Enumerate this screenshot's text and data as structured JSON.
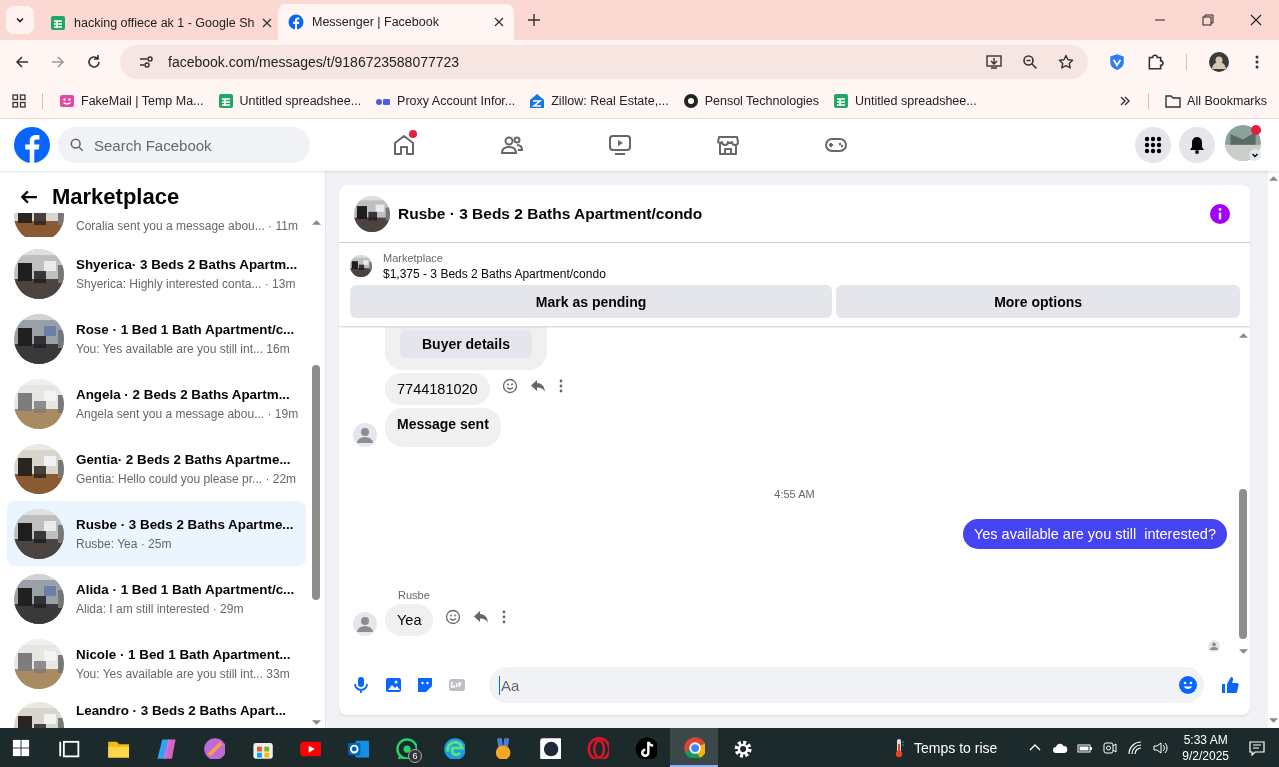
{
  "browser": {
    "tabs": [
      {
        "title": "hacking offiece ak 1 - Google Sh",
        "kind": "sheets",
        "selected": false
      },
      {
        "title": "Messenger | Facebook",
        "kind": "facebook",
        "selected": true
      }
    ],
    "url": "facebook.com/messages/t/9186723588077723",
    "bookmarks": [
      {
        "label": "FakeMail | Temp Ma...",
        "kind": "fakemail"
      },
      {
        "label": "Untitled spreadshee...",
        "kind": "sheets"
      },
      {
        "label": "Proxy Account Infor...",
        "kind": "proxy"
      },
      {
        "label": "Zillow: Real Estate,...",
        "kind": "zillow"
      },
      {
        "label": "Pensol Technologies",
        "kind": "pensol"
      },
      {
        "label": "Untitled spreadshee...",
        "kind": "sheets"
      }
    ],
    "all_bookmarks": "All Bookmarks"
  },
  "facebook": {
    "search": {
      "placeholder": "Search Facebook"
    },
    "nav": [
      {
        "kind": "home",
        "notification": true
      },
      {
        "kind": "friends",
        "notification": false
      },
      {
        "kind": "video",
        "notification": false
      },
      {
        "kind": "marketplace",
        "notification": false
      },
      {
        "kind": "gaming",
        "notification": false
      }
    ],
    "account_notification": true
  },
  "sidebar": {
    "title": "Marketplace",
    "conversations": [
      {
        "preview": "Coralia sent you a message abou...",
        "time": "· 11m",
        "selected": false
      },
      {
        "title": "Shyerica· 3 Beds 2 Baths Apartm...",
        "preview": "Shyerica: Highly interested conta...",
        "time": "· 13m",
        "selected": false
      },
      {
        "title": "Rose · 1 Bed 1 Bath Apartment/c...",
        "preview": "You: Yes available are you still int...",
        "time": "16m",
        "selected": false
      },
      {
        "title": "Angela · 2 Beds 2 Baths Apartm...",
        "preview": "Angela sent you a message abou...",
        "time": "· 19m",
        "selected": false
      },
      {
        "title": "Gentia· 2 Beds 2 Baths Apartme...",
        "preview": "Gentia: Hello could you please pr...",
        "time": "· 22m",
        "selected": false
      },
      {
        "title": "Rusbe · 3 Beds 2 Baths Apartme...",
        "preview": "Rusbe: Yea",
        "time": "· 25m",
        "selected": true
      },
      {
        "title": "Alida · 1 Bed 1 Bath Apartment/c...",
        "preview": "Alida: I am still interested",
        "time": "· 29m",
        "selected": false
      },
      {
        "title": "Nicole · 1 Bed 1 Bath Apartment...",
        "preview": "You: Yes available are you still int...",
        "time": "33m",
        "selected": false
      },
      {
        "title": "Leandro · 3 Beds 2 Baths Apart...",
        "selected": false
      }
    ]
  },
  "chat": {
    "title": "Rusbe · 3 Beds 2 Baths Apartment/condo",
    "listing": {
      "label": "Marketplace",
      "title": "$1,375 - 3 Beds 2 Baths Apartment/condo"
    },
    "actions": [
      "Mark as pending",
      "More options"
    ],
    "messages": [
      {
        "kind": "card",
        "text": "Buyer details"
      },
      {
        "kind": "incoming",
        "text": "7744181020",
        "tools": true,
        "avatar": false
      },
      {
        "kind": "incoming",
        "text": "Message sent",
        "tools": false,
        "avatar": true
      },
      {
        "kind": "timestamp",
        "text": "4:55 AM"
      },
      {
        "kind": "outgoing",
        "text": "Yes available are you still  interested?"
      },
      {
        "kind": "incoming",
        "sender": "Rusbe",
        "text": "Yea",
        "tools": true,
        "avatar": true
      }
    ],
    "composer": {
      "placeholder": "Aa"
    }
  },
  "taskbar": {
    "apps": [
      {
        "kind": "taskview",
        "selected": false
      },
      {
        "kind": "explorer",
        "selected": false
      },
      {
        "kind": "copilot",
        "selected": false
      },
      {
        "kind": "orb",
        "selected": false
      },
      {
        "kind": "store",
        "selected": false
      },
      {
        "kind": "youtube",
        "selected": false
      },
      {
        "kind": "outlook",
        "selected": false
      },
      {
        "kind": "whatsapp",
        "selected": false,
        "badge": "6"
      },
      {
        "kind": "edge",
        "selected": false
      },
      {
        "kind": "medal",
        "selected": false
      },
      {
        "kind": "dark",
        "selected": false
      },
      {
        "kind": "opera",
        "selected": false
      },
      {
        "kind": "tiktok",
        "selected": false
      },
      {
        "kind": "chrome",
        "selected": true
      },
      {
        "kind": "settings",
        "selected": false
      }
    ],
    "weather": "Temps to rise",
    "time": "5:33 AM",
    "date": "9/2/2025"
  }
}
